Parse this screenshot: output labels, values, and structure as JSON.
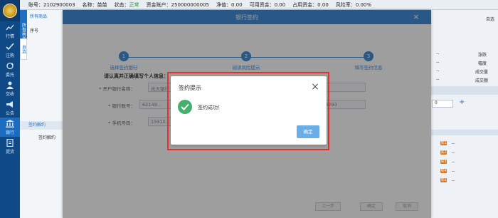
{
  "topbar": {
    "account": "账号：2102900003",
    "name": "名称：苗苗",
    "status_label": "状态：",
    "status_value": "正常",
    "fund_account": "资金账户：250000000005",
    "net": "净值：0.00",
    "available": "可用资金：0.00",
    "occupied": "占用资金：0.00",
    "risk": "风险率：0.00%"
  },
  "sidebar": {
    "items": [
      {
        "label": "行情",
        "icon": "chart-icon"
      },
      {
        "label": "注购",
        "icon": "check-icon"
      },
      {
        "label": "委托",
        "icon": "refresh-icon"
      },
      {
        "label": "交收",
        "icon": "person-icon"
      },
      {
        "label": "公告",
        "icon": "megaphone-icon"
      },
      {
        "label": "银行",
        "icon": "bank-icon"
      },
      {
        "label": "提货",
        "icon": "document-icon"
      }
    ]
  },
  "background": {
    "vertical_tab": "所有商品",
    "vertical_tab2": "自选",
    "tab_all": "所有商品",
    "col_seq": "序号",
    "sub_label": "签约解约",
    "sub_item": "签约解约",
    "right_header": "自选",
    "right_labels": [
      "涨跌",
      "幅度",
      "成交量",
      "成交额"
    ],
    "right_dashes": [
      "--",
      "--",
      "--",
      "--"
    ],
    "qty": "0",
    "plus": "+",
    "badges": [
      "买1",
      "买2",
      "买3",
      "买4",
      "买5"
    ],
    "badge_dash": "--"
  },
  "dialog": {
    "title": "银行签约",
    "close": "×",
    "steps": [
      {
        "num": "1",
        "label": "选择签约银行"
      },
      {
        "num": "2",
        "label": "阅读风险提示"
      },
      {
        "num": "3",
        "label": "填写签约信息"
      }
    ],
    "form_title": "请认真并正确填写个人信息：",
    "fields": [
      {
        "label": "* 开户银行名称：",
        "value": "光大银行"
      },
      {
        "label": "* 银行账号：",
        "value": "62149...",
        "extra": "014293"
      },
      {
        "label": "* 手机号码：",
        "value": "15910..."
      }
    ],
    "buttons": {
      "prev": "上一步",
      "confirm": "确定",
      "cancel": "取消"
    }
  },
  "modal": {
    "title": "签约提示",
    "close": "×",
    "message": "签约成功！",
    "ok": "确定",
    "colors": {
      "success": "#43b06b",
      "ok_button": "#6aaee8",
      "frame": "#e4322b"
    }
  }
}
